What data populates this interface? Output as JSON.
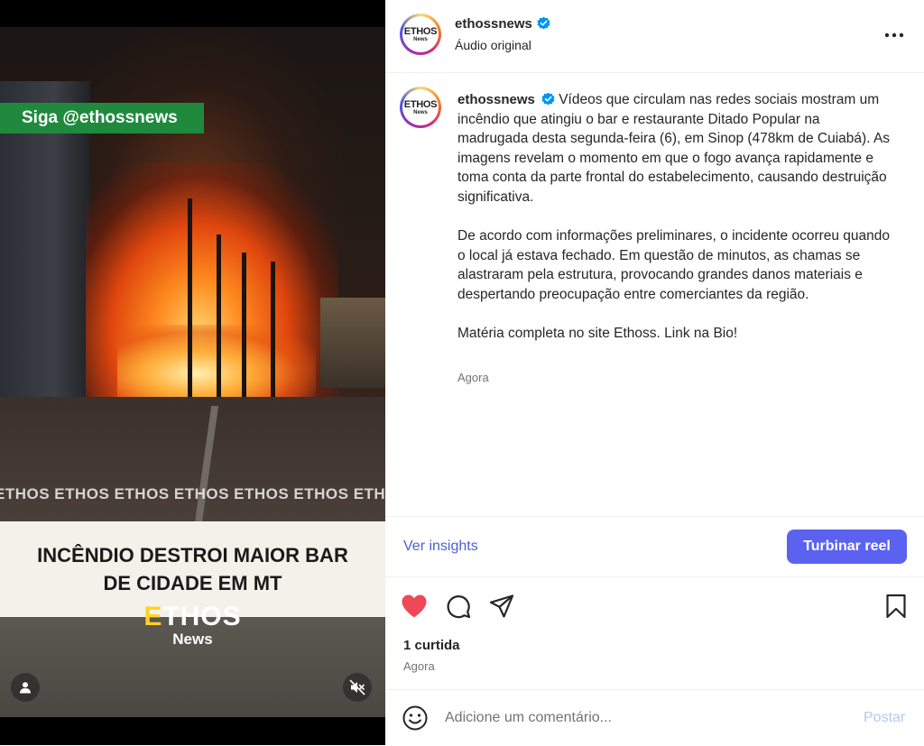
{
  "video": {
    "follow_tag": "Siga @ethossnews",
    "watermark": "ETHOS ETHOS ETHOS ETHOS ETHOS ETHOS ETHOS ETHOS",
    "headline_line1": "INCÊNDIO DESTROI MAIOR BAR",
    "headline_line2": "DE CIDADE EM MT",
    "logo_name_first": "E",
    "logo_name_rest": "THOS",
    "logo_sub": "News"
  },
  "header": {
    "avatar_brand": "ETHOS",
    "avatar_sub": "News",
    "username": "ethossnews",
    "audio": "Áudio original"
  },
  "caption": {
    "username": "ethossnews",
    "paragraph1": "Vídeos que circulam nas redes sociais mostram um incêndio que atingiu o bar e restaurante Ditado Popular na madrugada desta segunda-feira (6), em Sinop (478km de Cuiabá). As imagens revelam o momento em que o fogo avança rapidamente e toma conta da parte frontal do estabelecimento, causando destruição significativa.",
    "paragraph2": "De acordo com informações preliminares, o incidente ocorreu quando o local já estava fechado. Em questão de minutos, as chamas se alastraram pela estrutura, provocando grandes danos materiais e despertando preocupação entre comerciantes da região.",
    "paragraph3": "Matéria completa no site Ethoss. Link na Bio!",
    "time": "Agora"
  },
  "insights": {
    "link": "Ver insights",
    "boost_button": "Turbinar reel"
  },
  "engagement": {
    "likes": "1 curtida",
    "time": "Agora"
  },
  "comment": {
    "placeholder": "Adicione um comentário...",
    "post_button": "Postar"
  },
  "icons": {
    "verified": "verified-badge-icon",
    "more": "more-options-icon",
    "like": "heart-icon",
    "comment": "comment-icon",
    "share": "share-icon",
    "save": "bookmark-icon",
    "emoji": "emoji-icon",
    "user": "user-icon",
    "mute": "muted-speaker-icon"
  },
  "colors": {
    "accent": "#5b62f0",
    "link": "#4a5fd6",
    "like": "#ed4956",
    "verified": "#0095f6",
    "follow_tag": "#1f8a3e"
  }
}
